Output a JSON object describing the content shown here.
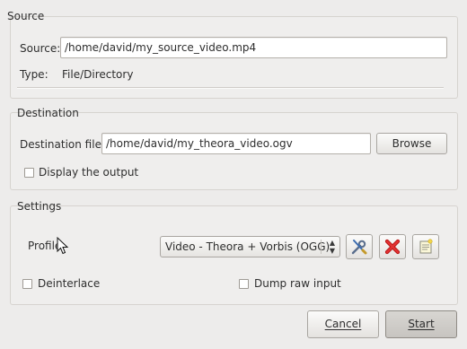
{
  "source": {
    "group_title": "Source",
    "source_label": "Source:",
    "source_value": "/home/david/my_source_video.mp4",
    "type_label": "Type:",
    "type_value": "File/Directory"
  },
  "destination": {
    "group_title": "Destination",
    "file_label": "Destination file:",
    "file_value": "/home/david/my_theora_video.ogv",
    "browse_label": "Browse",
    "display_output_label": "Display the output"
  },
  "settings": {
    "group_title": "Settings",
    "profile_label": "Profile",
    "profile_value": "Video - Theora + Vorbis (OGG)",
    "edit_profile_icon": "wrench-screwdriver-icon",
    "delete_profile_icon": "red-x-icon",
    "new_profile_icon": "new-document-icon",
    "deinterlace_label": "Deinterlace",
    "dump_raw_label": "Dump raw input"
  },
  "footer": {
    "cancel_label": "Cancel",
    "start_label": "Start"
  },
  "colors": {
    "background": "#edeceb",
    "delete_red": "#d21c1c"
  }
}
